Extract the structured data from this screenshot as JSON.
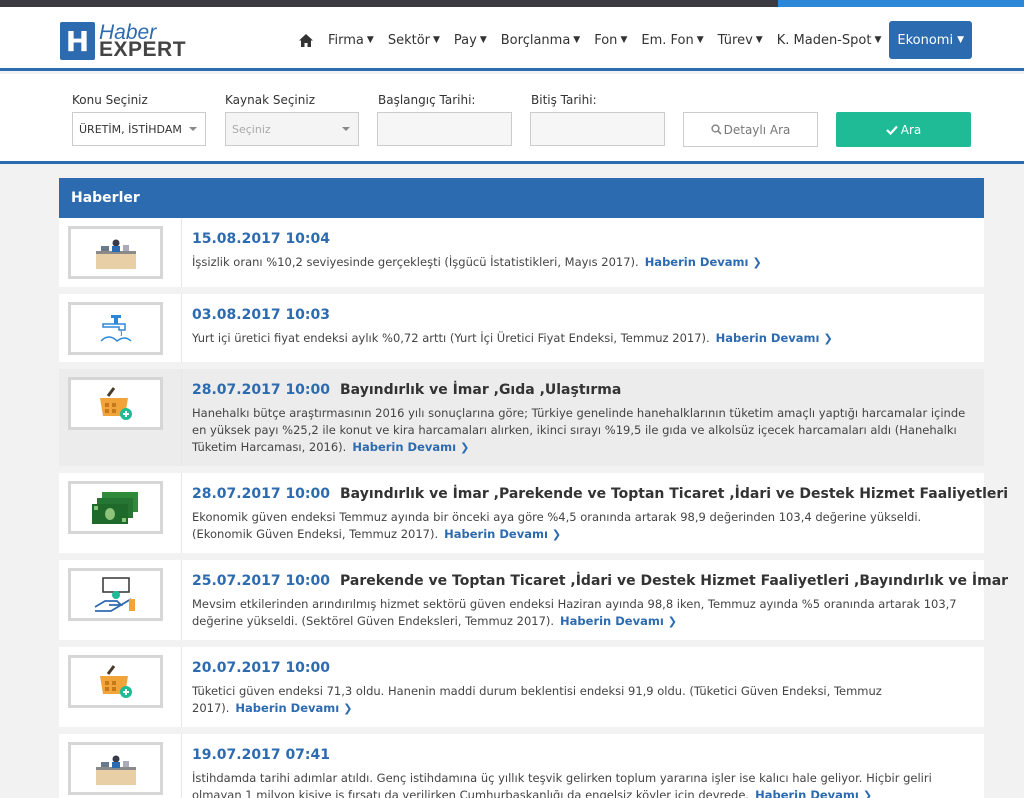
{
  "brand": {
    "mark": "H",
    "line1": "Haber",
    "line2": "EXPERT"
  },
  "nav": {
    "items": [
      {
        "label": "Firma"
      },
      {
        "label": "Sektör"
      },
      {
        "label": "Pay"
      },
      {
        "label": "Borçlanma"
      },
      {
        "label": "Fon"
      },
      {
        "label": "Em. Fon"
      },
      {
        "label": "Türev"
      },
      {
        "label": "K. Maden-Spot"
      }
    ],
    "active": "Ekonomi",
    "chevron": "⌄"
  },
  "filters": {
    "topic_label": "Konu Seçiniz",
    "topic_value": "ÜRETİM, İSTİHDAM",
    "source_label": "Kaynak Seçiniz",
    "source_value": "Seçiniz",
    "start_label": "Başlangıç Tarihi:",
    "end_label": "Bitiş Tarihi:",
    "detail_button": "Detaylı Ara",
    "search_button": "Ara"
  },
  "panel_title": "Haberler",
  "more_label": "Haberin Devamı",
  "news": [
    {
      "date": "15.08.2017 10:04",
      "category": "",
      "icon": "office-worker-icon",
      "text": "İşsizlik oranı %10,2 seviyesinde gerçekleşti (İşgücü İstatistikleri, Mayıs 2017)."
    },
    {
      "date": "03.08.2017 10:03",
      "category": "",
      "icon": "water-tap-icon",
      "text": "Yurt içi üretici fiyat endeksi aylık %0,72 arttı (Yurt İçi Üretici Fiyat Endeksi, Temmuz 2017)."
    },
    {
      "date": "28.07.2017 10:00",
      "category": "Bayındırlık ve İmar ,Gıda ,Ulaştırma",
      "icon": "shopping-basket-icon",
      "text": "Hanehalkı bütçe araştırmasının 2016 yılı sonuçlarına göre; Türkiye genelinde hanehalklarının tüketim amaçlı yaptığı harcamalar içinde en yüksek payı %25,2 ile konut ve kira harcamaları alırken, ikinci sırayı %19,5 ile gıda ve alkolsüz içecek harcamaları aldı (Hanehalkı Tüketim Harcaması, 2016)."
    },
    {
      "date": "28.07.2017 10:00",
      "category": "Bayındırlık ve İmar ,Parekende ve Toptan Ticaret ,İdari ve Destek Hizmet Faaliyetleri",
      "icon": "money-stack-icon",
      "text": "Ekonomik güven endeksi Temmuz ayında bir önceki aya göre %4,5 oranında artarak 98,9 değerinden 103,4 değerine yükseldi. (Ekonomik Güven Endeksi, Temmuz 2017)."
    },
    {
      "date": "25.07.2017 10:00",
      "category": "Parekende ve Toptan Ticaret ,İdari ve Destek Hizmet Faaliyetleri ,Bayındırlık ve İmar",
      "icon": "service-hand-icon",
      "text": "Mevsim etkilerinden arındırılmış hizmet sektörü güven endeksi Haziran ayında 98,8 iken, Temmuz ayında %5 oranında artarak 103,7 değerine yükseldi. (Sektörel Güven Endeksleri, Temmuz 2017)."
    },
    {
      "date": "20.07.2017 10:00",
      "category": "",
      "icon": "shopping-basket-icon",
      "text": "Tüketici güven endeksi 71,3 oldu. Hanenin maddi durum beklentisi endeksi 91,9 oldu. (Tüketici Güven Endeksi, Temmuz 2017)."
    },
    {
      "date": "19.07.2017 07:41",
      "category": "",
      "icon": "office-worker-icon",
      "text": "İstihdamda tarihi adımlar atıldı. Genç istihdamına üç yıllık teşvik gelirken toplum yararına işler ise kalıcı hale geliyor. Hiçbir geliri olmayan 1 milyon kişiye iş fırsatı da verilirken Cumhurbaşkanlığı da engelsiz köyler için devrede."
    }
  ]
}
